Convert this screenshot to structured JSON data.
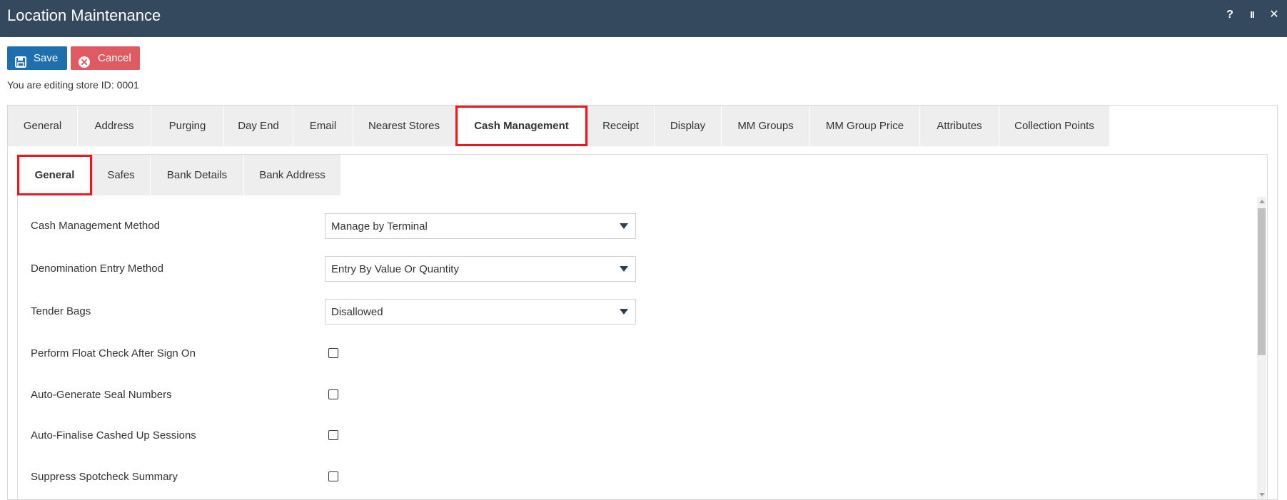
{
  "window": {
    "title": "Location Maintenance",
    "controls": {
      "help": "?",
      "pause": "II",
      "close": "✕"
    }
  },
  "toolbar": {
    "save_label": "Save",
    "save_icon": "floppy-disk-icon",
    "cancel_label": "Cancel",
    "cancel_icon": "close-circle-icon"
  },
  "editing_text": "You are editing store ID: 0001",
  "main_tabs": [
    {
      "label": "General",
      "active": false
    },
    {
      "label": "Address",
      "active": false
    },
    {
      "label": "Purging",
      "active": false
    },
    {
      "label": "Day End",
      "active": false
    },
    {
      "label": "Email",
      "active": false
    },
    {
      "label": "Nearest Stores",
      "active": false
    },
    {
      "label": "Cash Management",
      "active": true
    },
    {
      "label": "Receipt",
      "active": false
    },
    {
      "label": "Display",
      "active": false
    },
    {
      "label": "MM Groups",
      "active": false
    },
    {
      "label": "MM Group Price",
      "active": false
    },
    {
      "label": "Attributes",
      "active": false
    },
    {
      "label": "Collection Points",
      "active": false
    }
  ],
  "sub_tabs": [
    {
      "label": "General",
      "active": true
    },
    {
      "label": "Safes",
      "active": false
    },
    {
      "label": "Bank Details",
      "active": false
    },
    {
      "label": "Bank Address",
      "active": false
    }
  ],
  "form": {
    "cash_management_method": {
      "label": "Cash Management Method",
      "value": "Manage by Terminal"
    },
    "denomination_entry_method": {
      "label": "Denomination Entry Method",
      "value": "Entry By Value Or Quantity"
    },
    "tender_bags": {
      "label": "Tender Bags",
      "value": "Disallowed"
    },
    "perform_float_check": {
      "label": "Perform Float Check After Sign On",
      "checked": false
    },
    "auto_generate_seal_numbers": {
      "label": "Auto-Generate Seal Numbers",
      "checked": false
    },
    "auto_finalise_cashed_up": {
      "label": "Auto-Finalise Cashed Up Sessions",
      "checked": false
    },
    "suppress_spotcheck_summary": {
      "label": "Suppress Spotcheck Summary",
      "checked": false
    }
  },
  "colors": {
    "titlebar": "#34495e",
    "save_button": "#1f6fae",
    "cancel_button": "#e05a62",
    "highlight": "#e41b23",
    "tab_bg": "#eeeeee"
  }
}
